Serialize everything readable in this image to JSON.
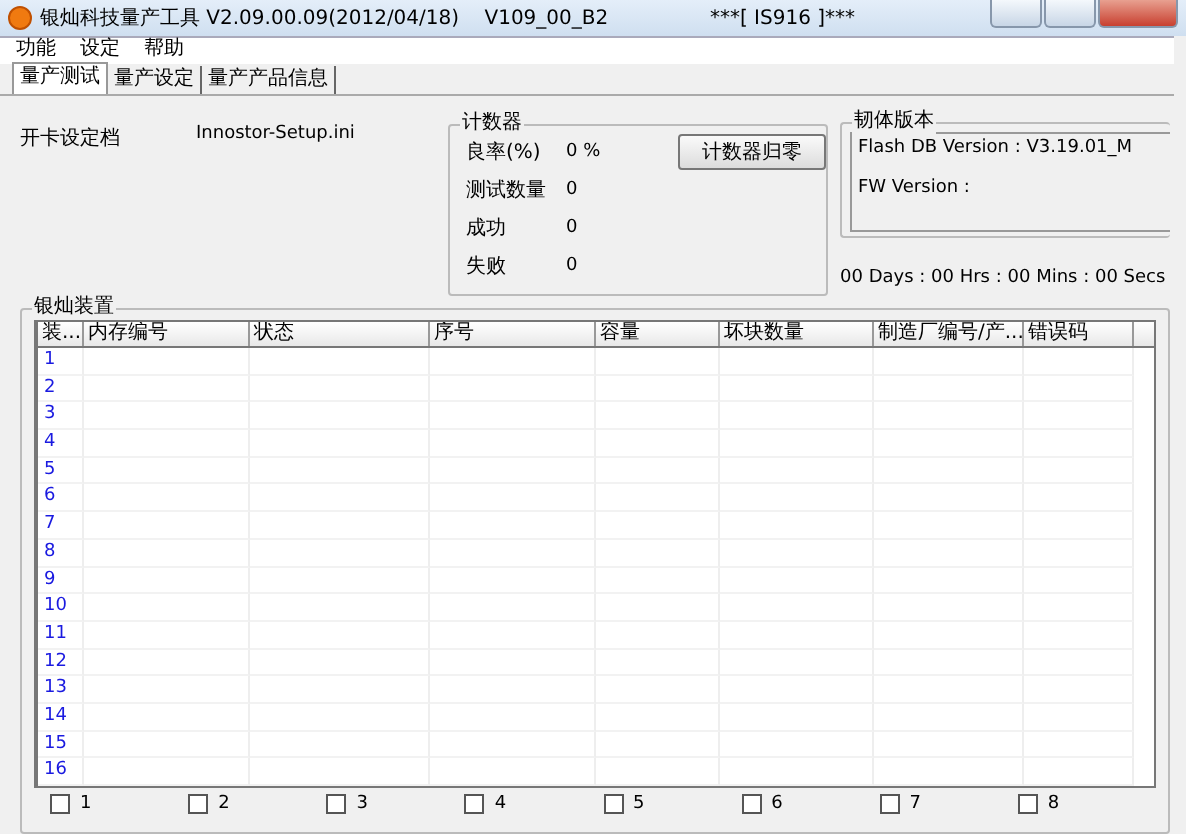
{
  "window": {
    "title": "银灿科技量产工具 V2.09.00.09(2012/04/18)    V109_00_B2                ***[ IS916 ]***"
  },
  "menu": [
    "功能",
    "设定",
    "帮助"
  ],
  "tabs": [
    {
      "label": "量产测试",
      "selected": true
    },
    {
      "label": "量产设定",
      "selected": false
    },
    {
      "label": "量产产品信息",
      "selected": false
    }
  ],
  "setup": {
    "label": "开卡设定档",
    "value": "Innostor-Setup.ini"
  },
  "counter": {
    "title": "计数器",
    "rows": [
      {
        "label": "良率(%)",
        "value": "0 %"
      },
      {
        "label": "测试数量",
        "value": "0"
      },
      {
        "label": "成功",
        "value": "0"
      },
      {
        "label": "失败",
        "value": "0"
      }
    ],
    "reset_button": "计数器归零"
  },
  "firmware": {
    "title": "韧体版本",
    "lines": [
      "Flash DB Version :  V3.19.01_M",
      "FW Version :"
    ]
  },
  "elapsed": "00 Days : 00 Hrs : 00 Mins : 00 Secs",
  "devices": {
    "title": "银灿装置",
    "columns": [
      "装...",
      "内存编号",
      "状态",
      "序号",
      "容量",
      "坏块数量",
      "制造厂编号/产...",
      "错误码"
    ],
    "rows": [
      {
        "number": "1"
      },
      {
        "number": "2"
      },
      {
        "number": "3"
      },
      {
        "number": "4"
      },
      {
        "number": "5"
      },
      {
        "number": "6"
      },
      {
        "number": "7"
      },
      {
        "number": "8"
      },
      {
        "number": "9"
      },
      {
        "number": "10"
      },
      {
        "number": "11"
      },
      {
        "number": "12"
      },
      {
        "number": "13"
      },
      {
        "number": "14"
      },
      {
        "number": "15"
      },
      {
        "number": "16"
      }
    ],
    "ports": [
      {
        "label": "1",
        "checked": false
      },
      {
        "label": "2",
        "checked": false
      },
      {
        "label": "3",
        "checked": false
      },
      {
        "label": "4",
        "checked": false
      },
      {
        "label": "5",
        "checked": false
      },
      {
        "label": "6",
        "checked": false
      },
      {
        "label": "7",
        "checked": false
      },
      {
        "label": "8",
        "checked": false
      }
    ]
  }
}
